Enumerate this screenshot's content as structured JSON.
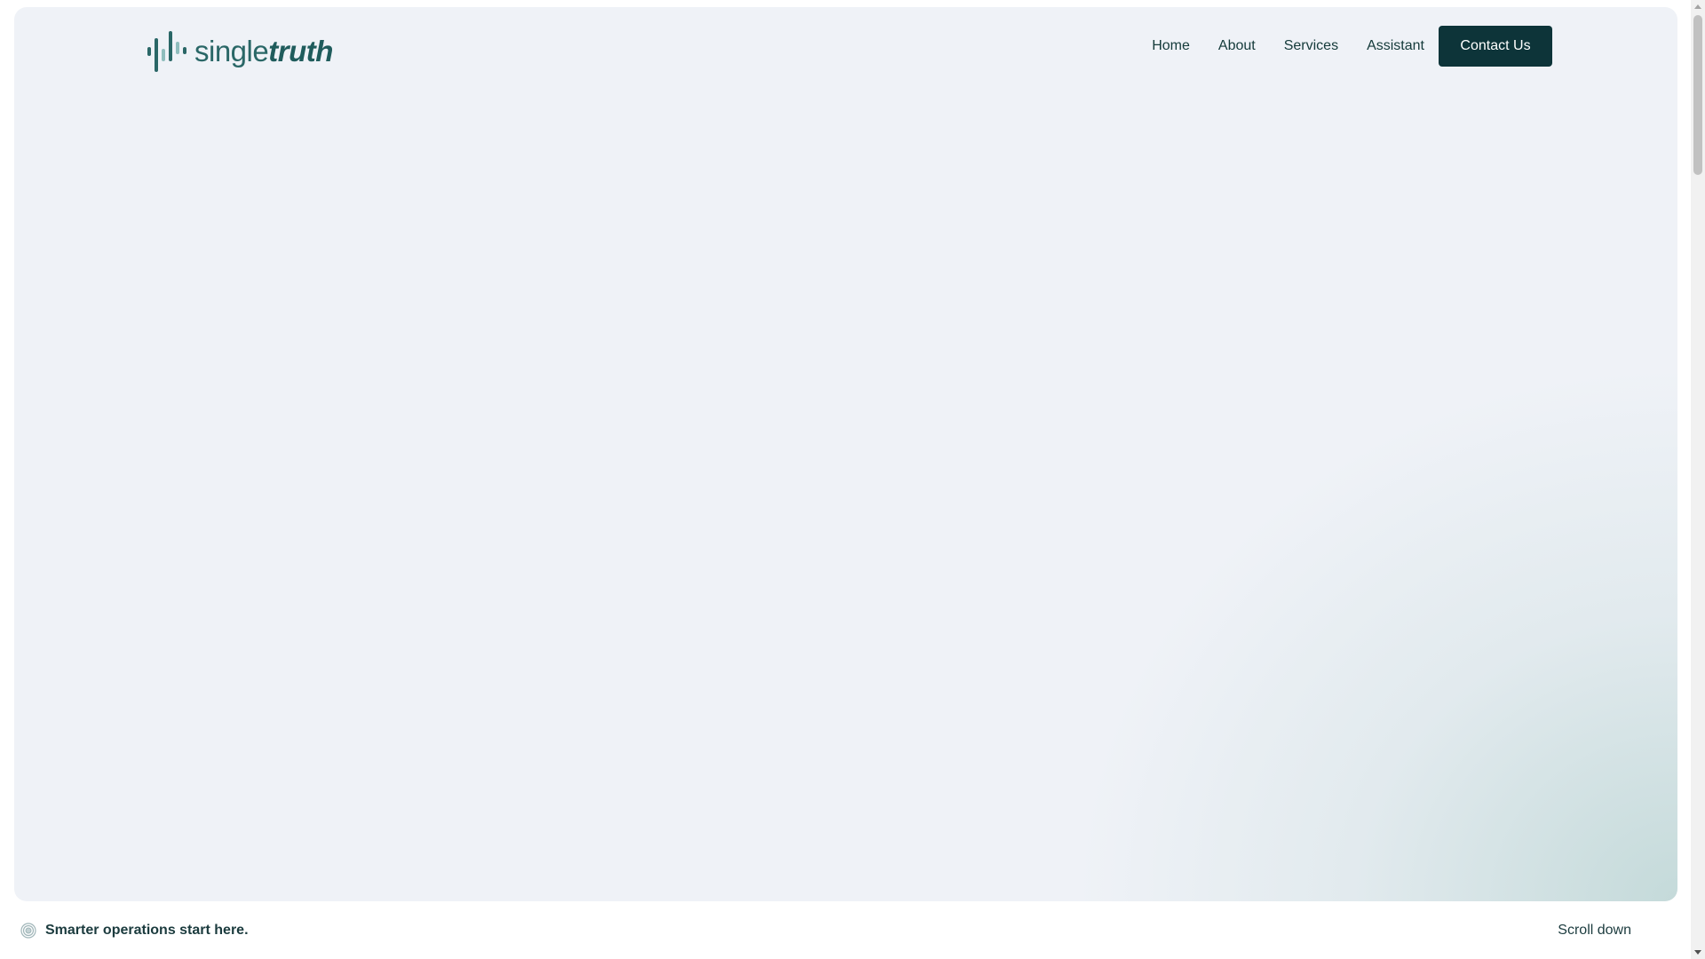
{
  "brand": {
    "name_regular": "single",
    "name_bold": "truth",
    "logo_color": "#2a6767",
    "logo_accent": "#8fbdbd"
  },
  "nav": {
    "links": [
      {
        "label": "Home"
      },
      {
        "label": "About"
      },
      {
        "label": "Services"
      },
      {
        "label": "Assistant"
      }
    ],
    "cta_label": "Contact Us",
    "cta_color": "#0d3439"
  },
  "hero": {
    "background": "#eff2f7",
    "gradient_accent": "#b6d2d0"
  },
  "footer": {
    "tagline": "Smarter operations start here.",
    "tagline_icon": "target-icon",
    "scroll_label": "Scroll down"
  }
}
